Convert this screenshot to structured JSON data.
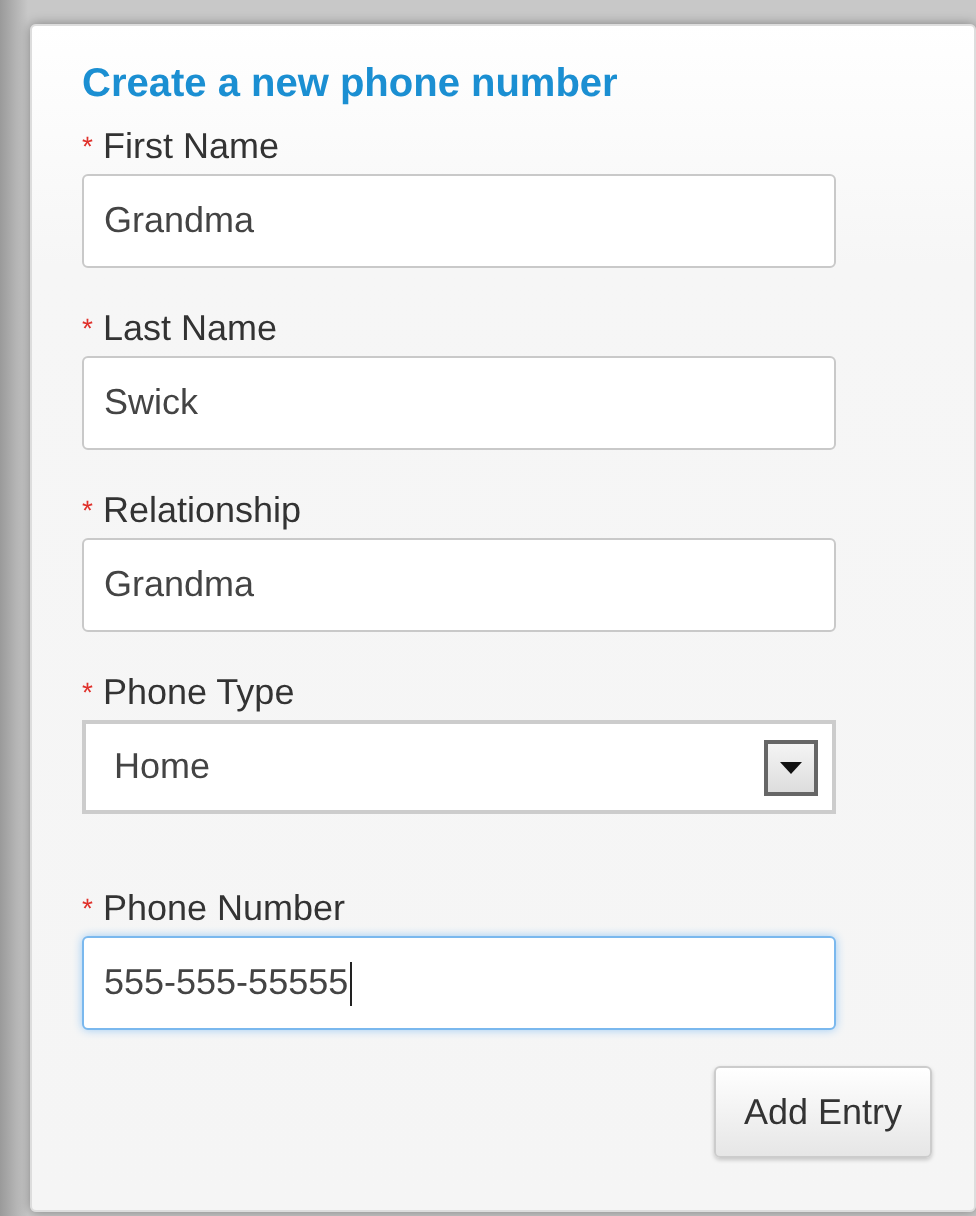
{
  "form": {
    "title": "Create a new phone number",
    "fields": [
      {
        "kind": "text",
        "required_mark": "*",
        "label": "First Name",
        "value": "Grandma",
        "focused": false
      },
      {
        "kind": "text",
        "required_mark": "*",
        "label": "Last Name",
        "value": "Swick",
        "focused": false
      },
      {
        "kind": "text",
        "required_mark": "*",
        "label": "Relationship",
        "value": "Grandma",
        "focused": false
      },
      {
        "kind": "select",
        "required_mark": "*",
        "label": "Phone Type",
        "value": "Home",
        "focused": false
      },
      {
        "kind": "text",
        "required_mark": "*",
        "label": "Phone Number",
        "value": "555-555-55555",
        "focused": true
      }
    ],
    "buttons": [
      "Add Entry"
    ]
  }
}
